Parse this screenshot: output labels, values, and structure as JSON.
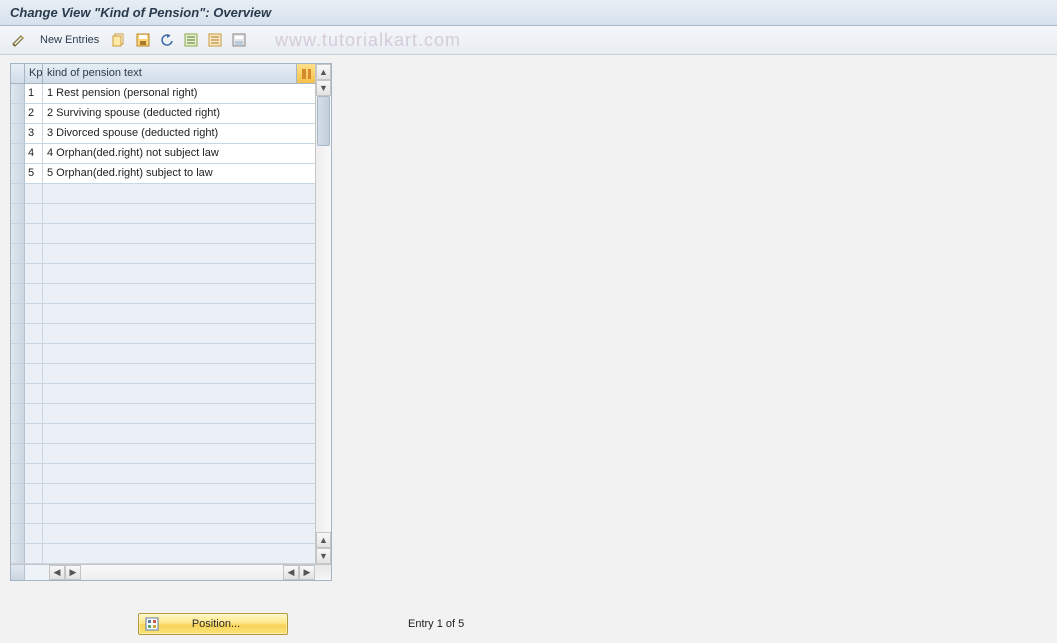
{
  "title": "Change View \"Kind of Pension\": Overview",
  "toolbar": {
    "new_entries": "New Entries"
  },
  "watermark": "www.tutorialkart.com",
  "table": {
    "headers": {
      "kp": "Kp",
      "text": "kind of pension text"
    },
    "rows": [
      {
        "kp": "1",
        "text": "1 Rest pension (personal right)"
      },
      {
        "kp": "2",
        "text": "2 Surviving spouse (deducted right)"
      },
      {
        "kp": "3",
        "text": "3 Divorced spouse (deducted right)"
      },
      {
        "kp": "4",
        "text": "4 Orphan(ded.right) not subject law"
      },
      {
        "kp": "5",
        "text": "5 Orphan(ded.right) subject to law"
      }
    ],
    "empty_row_count": 19
  },
  "footer": {
    "position_label": "Position...",
    "status": "Entry 1 of 5"
  }
}
